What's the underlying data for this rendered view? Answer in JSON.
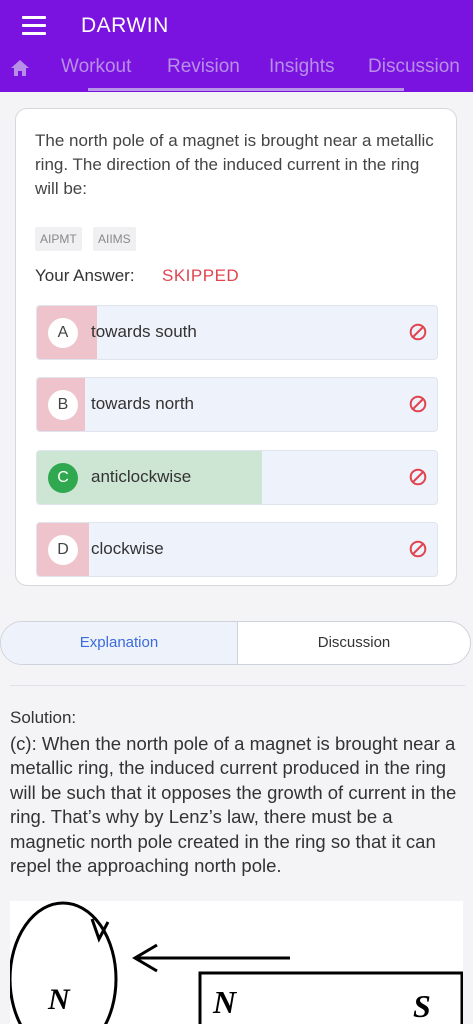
{
  "header": {
    "app_title": "DARWIN",
    "tabs": [
      {
        "label": "Workout"
      },
      {
        "label": "Revision"
      },
      {
        "label": "Insights"
      },
      {
        "label": "Discussion"
      }
    ]
  },
  "question": {
    "text": "The north pole of a magnet is brought near a metallic ring. The direction of the induced current in the ring will be:",
    "tags": [
      "AIPMT",
      "AIIMS"
    ],
    "your_answer_label": "Your Answer:",
    "your_answer_value": "SKIPPED",
    "options": [
      {
        "letter": "A",
        "text": "towards south"
      },
      {
        "letter": "B",
        "text": "towards north"
      },
      {
        "letter": "C",
        "text": "anticlockwise"
      },
      {
        "letter": "D",
        "text": "clockwise"
      }
    ]
  },
  "tabs_bottom": {
    "explanation": "Explanation",
    "discussion": "Discussion"
  },
  "solution": {
    "title": "Solution:",
    "text": "(c): When the north pole of a magnet is brought near a metallic ring, the induced current produced in the ring will be such that it opposes the growth of current in the ring. That’s why by Lenz’s law, there must be a magnetic north pole created in the ring so that it can repel the approaching north pole."
  },
  "figure": {
    "ring_label": "N",
    "magnet_north": "N",
    "magnet_south": "S"
  },
  "colors": {
    "app_bar": "#7a13e0",
    "skipped": "#e0454f",
    "correct": "#2fa84f",
    "wrong_fill": "#efc3cb",
    "correct_fill": "#cde6d3",
    "explanation_tab": "#3d6bdb"
  }
}
